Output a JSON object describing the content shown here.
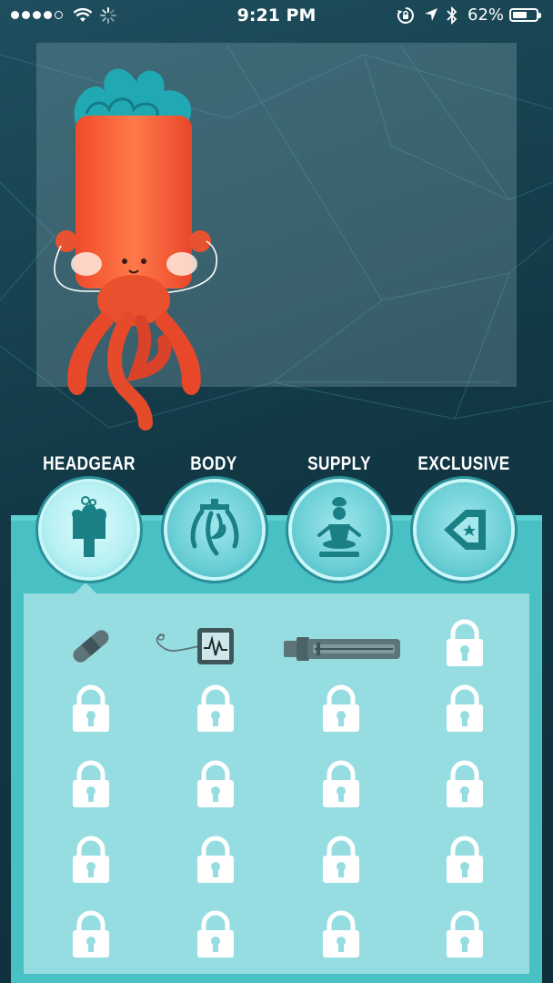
{
  "status_bar": {
    "time": "9:21 PM",
    "battery_percent": "62%",
    "battery_level": 0.62,
    "signal_bars_filled": 4,
    "icons": [
      "signal-dots",
      "wifi-icon",
      "loading-spinner-icon",
      "rotation-lock-icon",
      "location-arrow-icon",
      "bluetooth-icon",
      "battery-icon"
    ]
  },
  "categories": [
    {
      "label": "HEADGEAR",
      "icon": "headgear-icon",
      "active": true
    },
    {
      "label": "BODY",
      "icon": "body-icon",
      "active": false
    },
    {
      "label": "SUPPLY",
      "icon": "supply-icon",
      "active": false
    },
    {
      "label": "EXCLUSIVE",
      "icon": "exclusive-icon",
      "active": false
    }
  ],
  "items": [
    {
      "icon": "bandage-icon",
      "locked": false
    },
    {
      "icon": "heart-monitor-icon",
      "locked": false
    },
    {
      "icon": "syringe-icon",
      "locked": false
    },
    {
      "icon": "padlock-icon",
      "locked": true
    }
  ],
  "grid": {
    "columns": 4,
    "rows": 5,
    "locked_icon": "padlock-icon"
  },
  "colors": {
    "drawer": "#49c0c4",
    "panel": "#96dde2",
    "background": "#123845",
    "character": "#f0643a",
    "hair": "#21a9b3"
  }
}
